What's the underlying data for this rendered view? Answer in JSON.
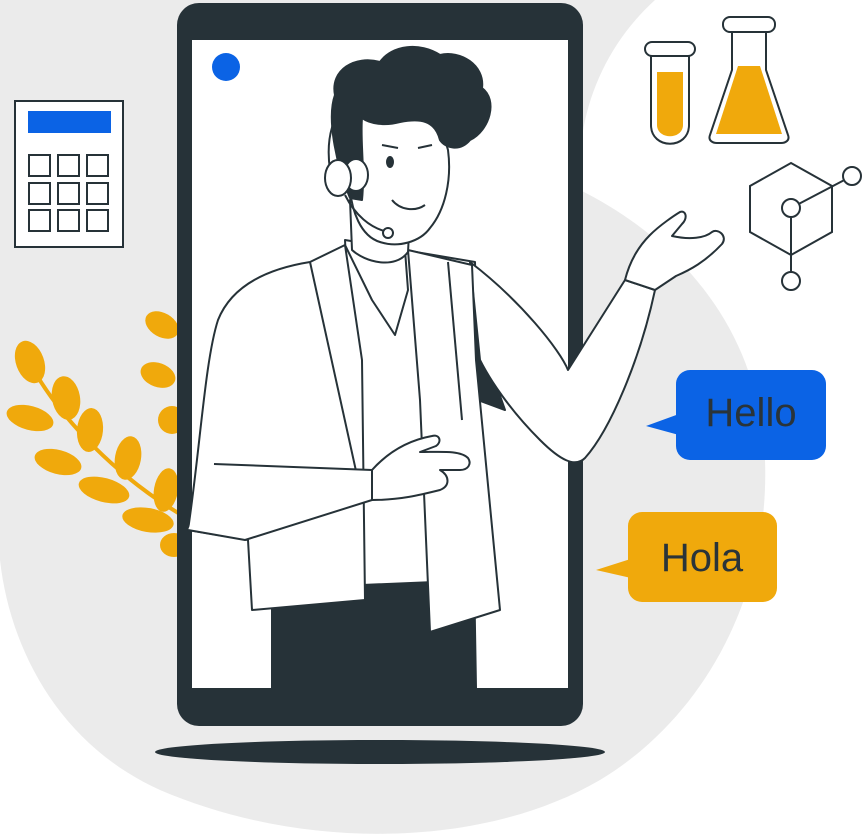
{
  "bubbles": {
    "hello": "Hello",
    "hola": "Hola"
  },
  "colors": {
    "dark": "#263238",
    "blue": "#0b63e5",
    "yellow": "#f0a90c",
    "background_blob": "#ebebeb",
    "white": "#ffffff"
  },
  "icons": [
    "calculator-icon",
    "test-tube-icon",
    "flask-icon",
    "molecule-icon",
    "plant-icon",
    "headset-icon",
    "camera-dot-icon"
  ]
}
